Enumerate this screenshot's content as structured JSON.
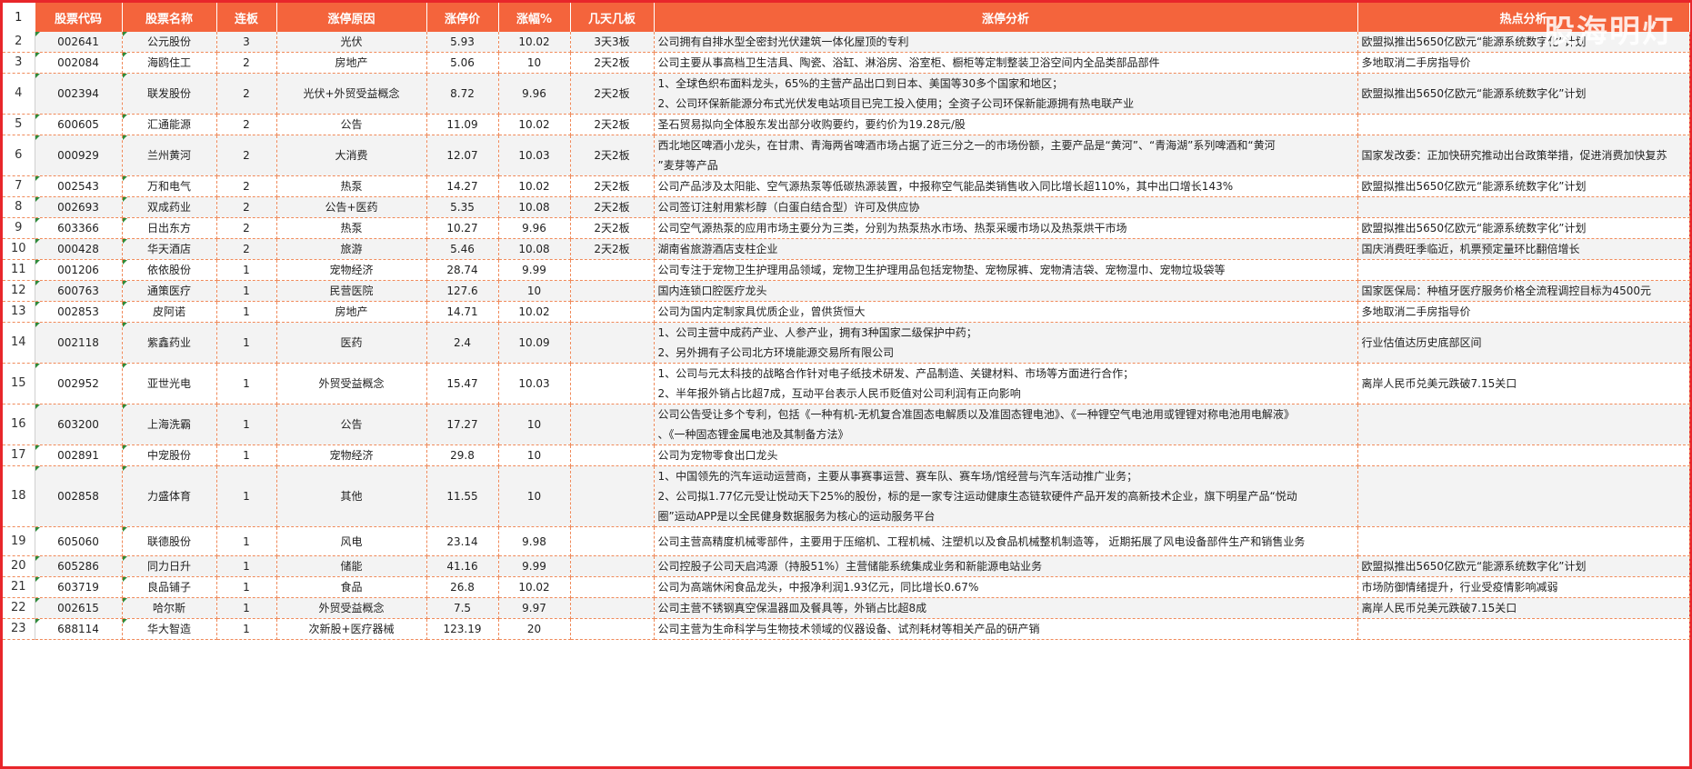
{
  "watermark": "股海明灯",
  "headers": [
    "1",
    "股票代码",
    "股票名称",
    "连板",
    "涨停原因",
    "涨停价",
    "涨幅%",
    "几天几板",
    "涨停分析",
    "热点分析"
  ],
  "rows": [
    {
      "rn": "2",
      "code": "002641",
      "name": "公元股份",
      "lianban": "3",
      "reason": "光伏",
      "price": "5.93",
      "pct": "10.02",
      "days": "3天3板",
      "analysis": [
        "公司拥有自排水型全密封光伏建筑一体化屋顶的专利"
      ],
      "hot": "欧盟拟推出5650亿欧元“能源系统数字化”计划"
    },
    {
      "rn": "3",
      "code": "002084",
      "name": "海鸥住工",
      "lianban": "2",
      "reason": "房地产",
      "price": "5.06",
      "pct": "10",
      "days": "2天2板",
      "analysis": [
        "公司主要从事高档卫生洁具、陶瓷、浴缸、淋浴房、浴室柜、橱柜等定制整装卫浴空间内全品类部品部件"
      ],
      "hot": "多地取消二手房指导价"
    },
    {
      "rn": "4",
      "code": "002394",
      "name": "联发股份",
      "lianban": "2",
      "reason": "光伏+外贸受益概念",
      "price": "8.72",
      "pct": "9.96",
      "days": "2天2板",
      "analysis": [
        "1、全球色织布面料龙头，65%的主营产品出口到日本、美国等30多个国家和地区；",
        "2、公司环保新能源分布式光伏发电站项目已完工投入使用；全资子公司环保新能源拥有热电联产业"
      ],
      "hot": "欧盟拟推出5650亿欧元“能源系统数字化”计划"
    },
    {
      "rn": "5",
      "code": "600605",
      "name": "汇通能源",
      "lianban": "2",
      "reason": "公告",
      "price": "11.09",
      "pct": "10.02",
      "days": "2天2板",
      "analysis": [
        "圣石贸易拟向全体股东发出部分收购要约，要约价为19.28元/股"
      ],
      "hot": ""
    },
    {
      "rn": "6",
      "code": "000929",
      "name": "兰州黄河",
      "lianban": "2",
      "reason": "大消费",
      "price": "12.07",
      "pct": "10.03",
      "days": "2天2板",
      "analysis": [
        "西北地区啤酒小龙头，在甘肃、青海两省啤酒市场占据了近三分之一的市场份额，主要产品是“黄河”、“青海湖”系列啤酒和“黄河",
        "”麦芽等产品"
      ],
      "hot": "国家发改委：正加快研究推动出台政策举措，促进消费加快复苏"
    },
    {
      "rn": "7",
      "code": "002543",
      "name": "万和电气",
      "lianban": "2",
      "reason": "热泵",
      "price": "14.27",
      "pct": "10.02",
      "days": "2天2板",
      "analysis": [
        "公司产品涉及太阳能、空气源热泵等低碳热源装置，中报称空气能品类销售收入同比增长超110%，其中出口增长143%"
      ],
      "hot": "欧盟拟推出5650亿欧元“能源系统数字化”计划"
    },
    {
      "rn": "8",
      "code": "002693",
      "name": "双成药业",
      "lianban": "2",
      "reason": "公告+医药",
      "price": "5.35",
      "pct": "10.08",
      "days": "2天2板",
      "analysis": [
        "公司签订注射用紫杉醇（白蛋白结合型）许可及供应协"
      ],
      "hot": ""
    },
    {
      "rn": "9",
      "code": "603366",
      "name": "日出东方",
      "lianban": "2",
      "reason": "热泵",
      "price": "10.27",
      "pct": "9.96",
      "days": "2天2板",
      "analysis": [
        "公司空气源热泵的应用市场主要分为三类，分别为热泵热水市场、热泵采暖市场以及热泵烘干市场"
      ],
      "hot": "欧盟拟推出5650亿欧元“能源系统数字化”计划"
    },
    {
      "rn": "10",
      "code": "000428",
      "name": "华天酒店",
      "lianban": "2",
      "reason": "旅游",
      "price": "5.46",
      "pct": "10.08",
      "days": "2天2板",
      "analysis": [
        "湖南省旅游酒店支柱企业"
      ],
      "hot": "国庆消费旺季临近，机票预定量环比翻倍增长"
    },
    {
      "rn": "11",
      "code": "001206",
      "name": "依依股份",
      "lianban": "1",
      "reason": "宠物经济",
      "price": "28.74",
      "pct": "9.99",
      "days": "",
      "analysis": [
        "公司专注于宠物卫生护理用品领域，宠物卫生护理用品包括宠物垫、宠物尿裤、宠物清洁袋、宠物湿巾、宠物垃圾袋等"
      ],
      "hot": ""
    },
    {
      "rn": "12",
      "code": "600763",
      "name": "通策医疗",
      "lianban": "1",
      "reason": "民营医院",
      "price": "127.6",
      "pct": "10",
      "days": "",
      "analysis": [
        "国内连锁口腔医疗龙头"
      ],
      "hot": "国家医保局：种植牙医疗服务价格全流程调控目标为4500元"
    },
    {
      "rn": "13",
      "code": "002853",
      "name": "皮阿诺",
      "lianban": "1",
      "reason": "房地产",
      "price": "14.71",
      "pct": "10.02",
      "days": "",
      "analysis": [
        "公司为国内定制家具优质企业，曾供货恒大"
      ],
      "hot": "多地取消二手房指导价"
    },
    {
      "rn": "14",
      "code": "002118",
      "name": "紫鑫药业",
      "lianban": "1",
      "reason": "医药",
      "price": "2.4",
      "pct": "10.09",
      "days": "",
      "analysis": [
        "1、公司主营中成药产业、人参产业，拥有3种国家二级保护中药；",
        "2、另外拥有子公司北方环境能源交易所有限公司"
      ],
      "hot": "行业估值达历史底部区间"
    },
    {
      "rn": "15",
      "code": "002952",
      "name": "亚世光电",
      "lianban": "1",
      "reason": "外贸受益概念",
      "price": "15.47",
      "pct": "10.03",
      "days": "",
      "analysis": [
        "1、公司与元太科技的战略合作针对电子纸技术研发、产品制造、关键材料、市场等方面进行合作；",
        "2、半年报外销占比超7成，互动平台表示人民币贬值对公司利润有正向影响"
      ],
      "hot": "离岸人民币兑美元跌破7.15关口"
    },
    {
      "rn": "16",
      "code": "603200",
      "name": "上海洗霸",
      "lianban": "1",
      "reason": "公告",
      "price": "17.27",
      "pct": "10",
      "days": "",
      "analysis": [
        "公司公告受让多个专利，包括《一种有机-无机复合准固态电解质以及准固态锂电池》、《一种锂空气电池用或锂锂对称电池用电解液》",
        "、《一种固态锂金属电池及其制备方法》"
      ],
      "hot": ""
    },
    {
      "rn": "17",
      "code": "002891",
      "name": "中宠股份",
      "lianban": "1",
      "reason": "宠物经济",
      "price": "29.8",
      "pct": "10",
      "days": "",
      "analysis": [
        "公司为宠物零食出口龙头"
      ],
      "hot": ""
    },
    {
      "rn": "18",
      "code": "002858",
      "name": "力盛体育",
      "lianban": "1",
      "reason": "其他",
      "price": "11.55",
      "pct": "10",
      "days": "",
      "analysis": [
        "1、中国领先的汽车运动运营商，主要从事赛事运营、赛车队、赛车场/馆经营与汽车活动推广业务；",
        "2、公司拟1.77亿元受让悦动天下25%的股份，标的是一家专注运动健康生态链软硬件产品开发的高新技术企业，旗下明星产品“悦动",
        "圈”运动APP是以全民健身数据服务为核心的运动服务平台"
      ],
      "hot": ""
    },
    {
      "rn": "19",
      "code": "605060",
      "name": "联德股份",
      "lianban": "1",
      "reason": "风电",
      "price": "23.14",
      "pct": "9.98",
      "days": "",
      "analysis": [
        "公司主营高精度机械零部件，主要用于压缩机、工程机械、注塑机以及食品机械整机制造等， 近期拓展了风电设备部件生产和销售业务"
      ],
      "hot": ""
    },
    {
      "rn": "20",
      "code": "605286",
      "name": "同力日升",
      "lianban": "1",
      "reason": "储能",
      "price": "41.16",
      "pct": "9.99",
      "days": "",
      "analysis": [
        "公司控股子公司天启鸿源（持股51%）主营储能系统集成业务和新能源电站业务"
      ],
      "hot": "欧盟拟推出5650亿欧元“能源系统数字化”计划"
    },
    {
      "rn": "21",
      "code": "603719",
      "name": "良品铺子",
      "lianban": "1",
      "reason": "食品",
      "price": "26.8",
      "pct": "10.02",
      "days": "",
      "analysis": [
        "公司为高端休闲食品龙头，中报净利润1.93亿元，同比增长0.67%"
      ],
      "hot": "市场防御情绪提升，行业受疫情影响减弱"
    },
    {
      "rn": "22",
      "code": "002615",
      "name": "哈尔斯",
      "lianban": "1",
      "reason": "外贸受益概念",
      "price": "7.5",
      "pct": "9.97",
      "days": "",
      "analysis": [
        "公司主营不锈钢真空保温器皿及餐具等，外销占比超8成"
      ],
      "hot": "离岸人民币兑美元跌破7.15关口"
    },
    {
      "rn": "23",
      "code": "688114",
      "name": "华大智造",
      "lianban": "1",
      "reason": "次新股+医疗器械",
      "price": "123.19",
      "pct": "20",
      "days": "",
      "analysis": [
        "公司主营为生命科学与生物技术领域的仪器设备、试剂耗材等相关产品的研产销"
      ],
      "hot": ""
    }
  ]
}
